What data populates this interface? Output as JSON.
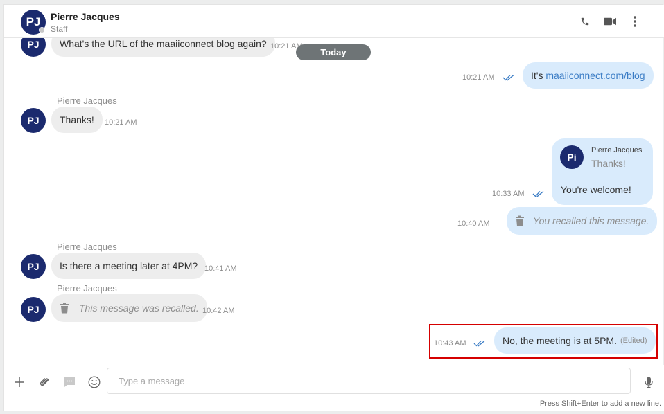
{
  "header": {
    "avatar_initials": "PJ",
    "name": "Pierre Jacques",
    "role": "Staff",
    "icons": [
      "phone-icon",
      "video-icon",
      "more-vertical-icon"
    ]
  },
  "date_separator": "Today",
  "messages": {
    "m1": {
      "avatar": "PJ",
      "text": "What's the URL of the maaiiconnect blog again?",
      "time": "10:21 AM"
    },
    "m2": {
      "text_prefix": "It's ",
      "link": "maaiiconnect.com/blog",
      "time": "10:21 AM"
    },
    "m3": {
      "sender": "Pierre Jacques",
      "avatar": "PJ",
      "text": "Thanks!",
      "time": "10:21 AM"
    },
    "m4": {
      "quote_avatar": "Pi",
      "quote_sender": "Pierre Jacques",
      "quote_text": "Thanks!",
      "text": "You're welcome!",
      "time": "10:33 AM"
    },
    "m5": {
      "text": "You recalled this message.",
      "time": "10:40 AM"
    },
    "m6": {
      "sender": "Pierre Jacques",
      "avatar": "PJ",
      "text": "Is there a meeting later at 4PM?",
      "time": "10:41 AM"
    },
    "m7": {
      "sender": "Pierre Jacques",
      "avatar": "PJ",
      "text": "This message was recalled.",
      "time": "10:42 AM"
    },
    "m8": {
      "text": "No, the meeting is at 5PM.",
      "edited": "(Edited)",
      "time": "10:43 AM"
    }
  },
  "composer": {
    "placeholder": "Type a message",
    "hint": "Press Shift+Enter to add a new line."
  },
  "colors": {
    "avatar": "#1b2a6e",
    "outgoing_bubble": "#d9ebfc",
    "incoming_bubble": "#ededed",
    "link": "#3a7cc5",
    "highlight": "#d50000"
  }
}
